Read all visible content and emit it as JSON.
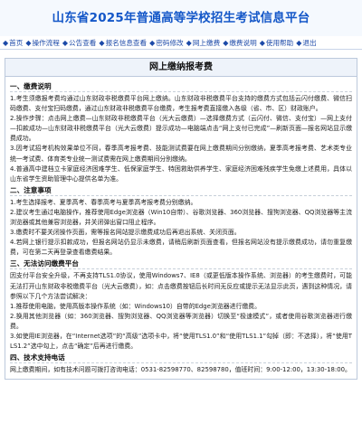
{
  "header": {
    "title": "山东省2025年普通高等学校招生考试信息平台"
  },
  "nav": [
    {
      "label": "首页",
      "icon": "diamond-bullet-icon"
    },
    {
      "label": "操作流程",
      "icon": "diamond-bullet-icon"
    },
    {
      "label": "公告查看",
      "icon": "diamond-bullet-icon"
    },
    {
      "label": "报名信息查看",
      "icon": "diamond-bullet-icon"
    },
    {
      "label": "密码修改",
      "icon": "diamond-bullet-icon"
    },
    {
      "label": "网上缴费",
      "icon": "diamond-bullet-icon"
    },
    {
      "label": "缴费说明",
      "icon": "diamond-bullet-icon"
    },
    {
      "label": "使用帮助",
      "icon": "diamond-bullet-icon"
    },
    {
      "label": "退出",
      "icon": "diamond-bullet-icon"
    }
  ],
  "page": {
    "title": "网上缴纳报考费"
  },
  "sections": [
    {
      "heading": "一、缴费说明",
      "paragraphs": [
        "1.考生须缴报考费均通过山东财政非税缴费平台网上缴纳。山东财政非税缴费平台支持的缴费方式包括云闪付缴费、微信扫码缴费、支付宝扫码缴费，通过山东财政非税缴费平台缴费，考生报考费直接缴入各级（省、市、区）财政账户。",
        "2.操作步骤：点击网上缴费—山东财政非税缴费平台（光大云缴费）—选择缴费方式（云闪付、微信、支付宝）—网上支付—扣款成功—山东财政非税缴费平台（光大云缴费）提示成功—电脑端点击“网上支付已完成”—刷新页面—报名网站显示缴费成功。",
        "3.因考试招考机构效果单位不同，春季高考报考费、技能测试费要在网上缴费期间分别缴纳，夏季高考报考费、艺术类专业统一考试费、体育类专业统一测试费需在网上缴费期间分别缴纳。",
        "4.普通高中建档立卡家庭经济困难学生、低保家庭学生、特困救助供养学生、家庭经济困难残疾学生免缴上述费用，具体以山东省学生资助管理中心提供名单为准。"
      ]
    },
    {
      "heading": "二、注意事项",
      "paragraphs": [
        "1.考生选择报考、夏季高考、春季高考与夏季高考报考费分别缴纳。",
        "2.建议考生通过电脑操作，推荐使用Edge浏览器（Win10自带）、谷歌浏览器、360浏览器、搜狗浏览器、QQ浏览器等主流浏览器或其他兼容浏览器，并关闭弹出窗口阻止程序。",
        "3.缴费时不要关闭操作页面，需等报名网站提示缴费成功后再退出系统、关闭页面。",
        "4.若网上银行提示扣款成功，但报名网站仍显示未缴费，请稍后刷新页面查看，但报名网站没有提示缴费成功，请勿重复缴费，可在第二天再登录查看缴费结果。"
      ]
    },
    {
      "heading": "三、无法访问缴费平台",
      "paragraphs": [
        "因支付平台安全升级，不再支持TLS1.0协议，使用Windows7、IE8（或更低版本操作系统、浏览器）的考生缴费时，可能无法打开山东财政非税缴费平台（光大云缴费），如：点击缴费按钮后长时间无反应或提示无法显示此页，遇到这种情况，请参照以下几个方法尝试解决：",
        "1.推荐使用电脑，使用高版本操作系统（如：Windows10）自带的Edge浏览器进行缴费。",
        "2.换用其他浏览器（如：360浏览器、搜狗浏览器、QQ浏览器等浏览器）切换至“极速模式”，或者使用谷歌浏览器进行缴费。",
        "3.如使用IE浏览器，在“Internet选项”的“高级”选项卡中，将“使用TLS1.0”和“使用TLS1.1”勾掉（即：不选择），将“使用TLS1.2”选中勾上，点击“确定”后再进行缴费。"
      ]
    },
    {
      "heading": "四、技术支持电话",
      "paragraphs": [
        "网上缴费期间，如有技术问题可拨打咨询电话：0531-82598770、82598780，值班时间：9:00-12:00，13:30-18:00。"
      ]
    }
  ],
  "colors": {
    "title_blue": "#1457c8",
    "nav_blue": "#1d4aa8",
    "header_bg": "#f5f9fe",
    "border": "#bcc9dc"
  }
}
